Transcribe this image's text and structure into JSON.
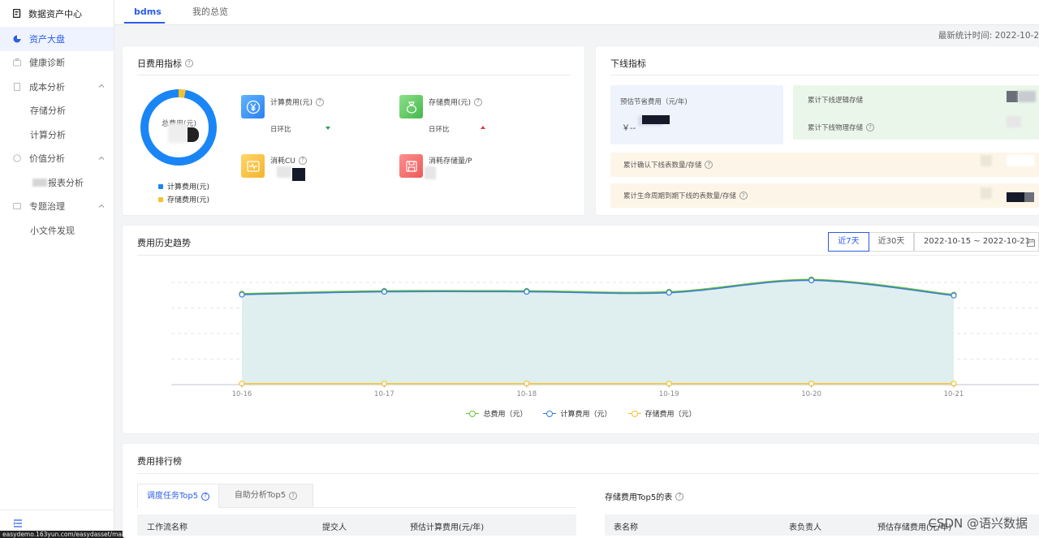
{
  "sidebar": {
    "brand": "数据资产中心",
    "items": [
      {
        "label": "资产大盘",
        "active": true
      },
      {
        "label": "健康诊断"
      },
      {
        "label": "成本分析"
      },
      {
        "label": "存储分析"
      },
      {
        "label": "计算分析"
      },
      {
        "label": "价值分析"
      },
      {
        "label": "报表分析"
      },
      {
        "label": "专题治理"
      },
      {
        "label": "小文件发现"
      }
    ],
    "url_tooltip": "easydemo.163yun.com/easydasset/main/assets-market"
  },
  "topbar": {
    "tabs": [
      {
        "label": "bdms",
        "active": true
      },
      {
        "label": "我的总览"
      }
    ]
  },
  "last_updated": "最新统计时间: 2022-10-2",
  "daily_cost": {
    "title": "日费用指标",
    "donut_label": "总费用(元)",
    "legend": [
      {
        "label": "计算费用(元)",
        "color": "#1a86f5"
      },
      {
        "label": "存储费用(元)",
        "color": "#f5c22d"
      }
    ],
    "metrics": [
      {
        "label": "计算费用(元)",
        "sub": "日环比"
      },
      {
        "label": "存储费用(元)",
        "sub": "日环比"
      },
      {
        "label": "消耗CU"
      },
      {
        "label": "消耗存储量/P"
      }
    ],
    "compute_share": 0.97
  },
  "offline": {
    "title": "下线指标",
    "saving_label": "预估节省费用（元/年)",
    "saving_value": "￥--",
    "logical_label": "累计下线逻辑存储",
    "physical_label": "累计下线物理存储",
    "confirmed_label": "累计确认下线表数量/存储",
    "lifecycle_label": "累计生命周期到期下线的表数量/存储"
  },
  "trend": {
    "title": "费用历史趋势",
    "btn_7": "近7天",
    "btn_30": "近30天",
    "date_range": "2022-10-15 ~ 2022-10-21"
  },
  "chart_data": {
    "type": "area",
    "x": [
      "10-16",
      "10-17",
      "10-18",
      "10-19",
      "10-20",
      "10-21"
    ],
    "series": [
      {
        "name": "总费用（元）",
        "color": "#67c23a",
        "values": [
          96,
          99,
          99,
          98,
          111,
          95
        ]
      },
      {
        "name": "计算费用（元）",
        "color": "#3a7bd5",
        "values": [
          95,
          98,
          98,
          97,
          110,
          94
        ]
      },
      {
        "name": "存储费用（元）",
        "color": "#f5c22d",
        "values": [
          1,
          1,
          1,
          1,
          1,
          1
        ]
      }
    ],
    "ylim": [
      0,
      125
    ],
    "grid": true,
    "legend_position": "bottom"
  },
  "ranking": {
    "title": "费用排行榜",
    "tab1": "调度任务Top5",
    "tab2": "自助分析Top5",
    "left_columns": [
      "工作流名称",
      "提交人",
      "预估计算费用(元/年)"
    ],
    "right_title": "存储费用Top5的表",
    "right_columns": [
      "表名称",
      "表负责人",
      "预估存储费用(元/年)"
    ],
    "watermark": "CSDN @语兴数据"
  }
}
